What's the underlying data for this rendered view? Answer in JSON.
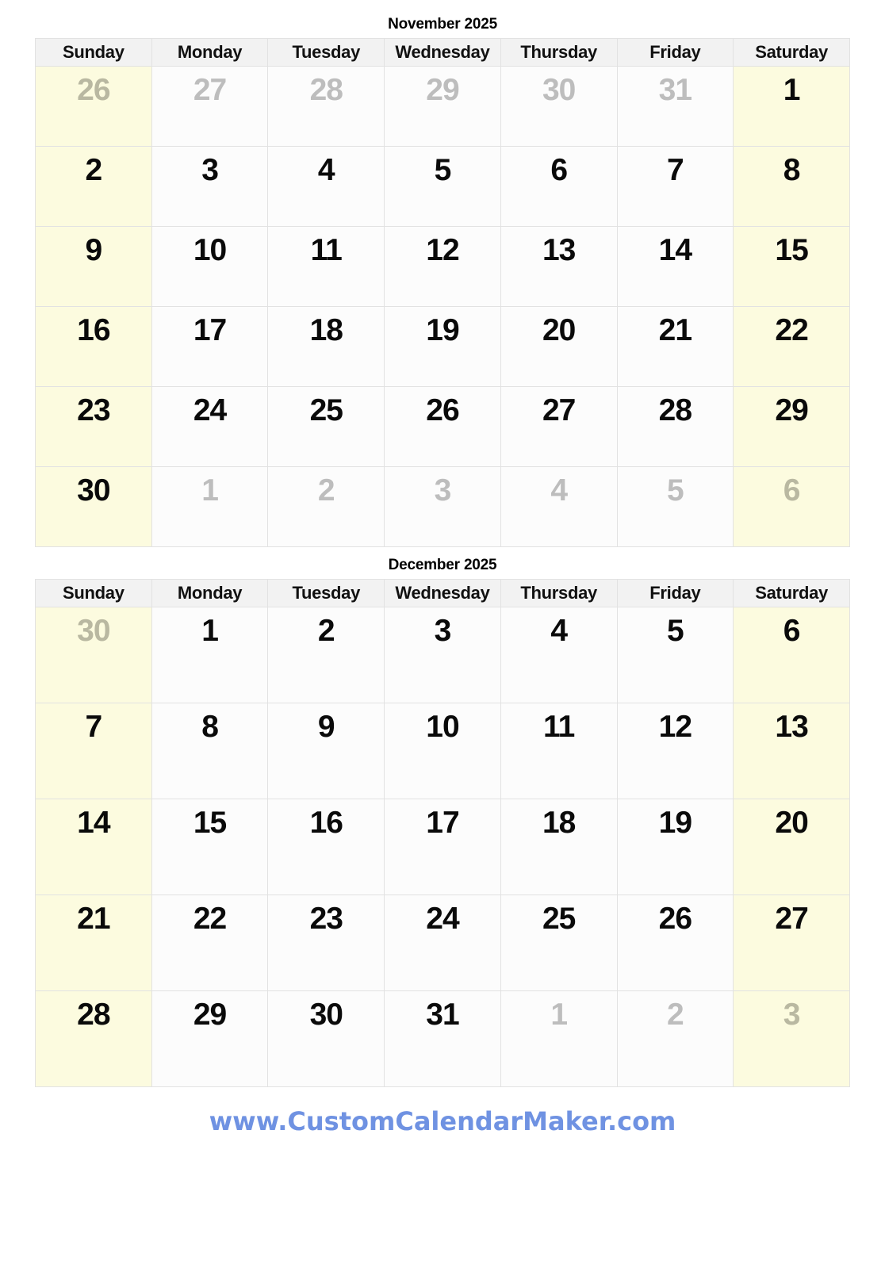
{
  "weekdays": [
    "Sunday",
    "Monday",
    "Tuesday",
    "Wednesday",
    "Thursday",
    "Friday",
    "Saturday"
  ],
  "colors": {
    "weekend_background": "#fcfbdf",
    "weekday_background": "#fcfcfc",
    "header_background": "#f2f2f2",
    "grid_line": "#e2e2e2",
    "day_text": "#0a0a0a",
    "muted_day_text": "#bdbdbd",
    "muted_day_text_on_weekend": "#b9b8a1",
    "footer_link": "#6f92e2"
  },
  "months": [
    {
      "title": "November 2025",
      "weeks": [
        [
          {
            "day": "26",
            "muted": true,
            "weekend": true
          },
          {
            "day": "27",
            "muted": true,
            "weekend": false
          },
          {
            "day": "28",
            "muted": true,
            "weekend": false
          },
          {
            "day": "29",
            "muted": true,
            "weekend": false
          },
          {
            "day": "30",
            "muted": true,
            "weekend": false
          },
          {
            "day": "31",
            "muted": true,
            "weekend": false
          },
          {
            "day": "1",
            "muted": false,
            "weekend": true
          }
        ],
        [
          {
            "day": "2",
            "muted": false,
            "weekend": true
          },
          {
            "day": "3",
            "muted": false,
            "weekend": false
          },
          {
            "day": "4",
            "muted": false,
            "weekend": false
          },
          {
            "day": "5",
            "muted": false,
            "weekend": false
          },
          {
            "day": "6",
            "muted": false,
            "weekend": false
          },
          {
            "day": "7",
            "muted": false,
            "weekend": false
          },
          {
            "day": "8",
            "muted": false,
            "weekend": true
          }
        ],
        [
          {
            "day": "9",
            "muted": false,
            "weekend": true
          },
          {
            "day": "10",
            "muted": false,
            "weekend": false
          },
          {
            "day": "11",
            "muted": false,
            "weekend": false
          },
          {
            "day": "12",
            "muted": false,
            "weekend": false
          },
          {
            "day": "13",
            "muted": false,
            "weekend": false
          },
          {
            "day": "14",
            "muted": false,
            "weekend": false
          },
          {
            "day": "15",
            "muted": false,
            "weekend": true
          }
        ],
        [
          {
            "day": "16",
            "muted": false,
            "weekend": true
          },
          {
            "day": "17",
            "muted": false,
            "weekend": false
          },
          {
            "day": "18",
            "muted": false,
            "weekend": false
          },
          {
            "day": "19",
            "muted": false,
            "weekend": false
          },
          {
            "day": "20",
            "muted": false,
            "weekend": false
          },
          {
            "day": "21",
            "muted": false,
            "weekend": false
          },
          {
            "day": "22",
            "muted": false,
            "weekend": true
          }
        ],
        [
          {
            "day": "23",
            "muted": false,
            "weekend": true
          },
          {
            "day": "24",
            "muted": false,
            "weekend": false
          },
          {
            "day": "25",
            "muted": false,
            "weekend": false
          },
          {
            "day": "26",
            "muted": false,
            "weekend": false
          },
          {
            "day": "27",
            "muted": false,
            "weekend": false
          },
          {
            "day": "28",
            "muted": false,
            "weekend": false
          },
          {
            "day": "29",
            "muted": false,
            "weekend": true
          }
        ],
        [
          {
            "day": "30",
            "muted": false,
            "weekend": true
          },
          {
            "day": "1",
            "muted": true,
            "weekend": false
          },
          {
            "day": "2",
            "muted": true,
            "weekend": false
          },
          {
            "day": "3",
            "muted": true,
            "weekend": false
          },
          {
            "day": "4",
            "muted": true,
            "weekend": false
          },
          {
            "day": "5",
            "muted": true,
            "weekend": false
          },
          {
            "day": "6",
            "muted": true,
            "weekend": true
          }
        ]
      ]
    },
    {
      "title": "December 2025",
      "weeks": [
        [
          {
            "day": "30",
            "muted": true,
            "weekend": true
          },
          {
            "day": "1",
            "muted": false,
            "weekend": false
          },
          {
            "day": "2",
            "muted": false,
            "weekend": false
          },
          {
            "day": "3",
            "muted": false,
            "weekend": false
          },
          {
            "day": "4",
            "muted": false,
            "weekend": false
          },
          {
            "day": "5",
            "muted": false,
            "weekend": false
          },
          {
            "day": "6",
            "muted": false,
            "weekend": true
          }
        ],
        [
          {
            "day": "7",
            "muted": false,
            "weekend": true
          },
          {
            "day": "8",
            "muted": false,
            "weekend": false
          },
          {
            "day": "9",
            "muted": false,
            "weekend": false
          },
          {
            "day": "10",
            "muted": false,
            "weekend": false
          },
          {
            "day": "11",
            "muted": false,
            "weekend": false
          },
          {
            "day": "12",
            "muted": false,
            "weekend": false
          },
          {
            "day": "13",
            "muted": false,
            "weekend": true
          }
        ],
        [
          {
            "day": "14",
            "muted": false,
            "weekend": true
          },
          {
            "day": "15",
            "muted": false,
            "weekend": false
          },
          {
            "day": "16",
            "muted": false,
            "weekend": false
          },
          {
            "day": "17",
            "muted": false,
            "weekend": false
          },
          {
            "day": "18",
            "muted": false,
            "weekend": false
          },
          {
            "day": "19",
            "muted": false,
            "weekend": false
          },
          {
            "day": "20",
            "muted": false,
            "weekend": true
          }
        ],
        [
          {
            "day": "21",
            "muted": false,
            "weekend": true
          },
          {
            "day": "22",
            "muted": false,
            "weekend": false
          },
          {
            "day": "23",
            "muted": false,
            "weekend": false
          },
          {
            "day": "24",
            "muted": false,
            "weekend": false
          },
          {
            "day": "25",
            "muted": false,
            "weekend": false
          },
          {
            "day": "26",
            "muted": false,
            "weekend": false
          },
          {
            "day": "27",
            "muted": false,
            "weekend": true
          }
        ],
        [
          {
            "day": "28",
            "muted": false,
            "weekend": true
          },
          {
            "day": "29",
            "muted": false,
            "weekend": false
          },
          {
            "day": "30",
            "muted": false,
            "weekend": false
          },
          {
            "day": "31",
            "muted": false,
            "weekend": false
          },
          {
            "day": "1",
            "muted": true,
            "weekend": false
          },
          {
            "day": "2",
            "muted": true,
            "weekend": false
          },
          {
            "day": "3",
            "muted": true,
            "weekend": true
          }
        ]
      ]
    }
  ],
  "footer": {
    "link_text": "www.CustomCalendarMaker.com"
  }
}
